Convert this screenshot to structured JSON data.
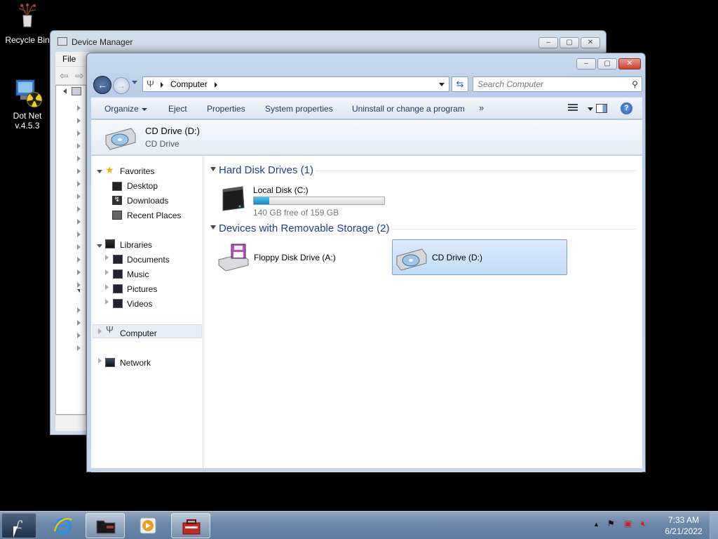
{
  "desktop": {
    "icons": [
      {
        "label": "Recycle Bin",
        "icon": "recycle-bin-icon"
      },
      {
        "label": "Dot Net\nv.4.5.3",
        "line1": "Dot Net",
        "line2": "v.4.5.3",
        "icon": "dotnet-installer-icon"
      }
    ]
  },
  "device_manager": {
    "title": "Device Manager",
    "menu": {
      "file": "File"
    }
  },
  "explorer": {
    "address": {
      "crumbs": [
        "Computer"
      ]
    },
    "search": {
      "placeholder": "Search Computer"
    },
    "commands": {
      "organize": "Organize",
      "eject": "Eject",
      "properties": "Properties",
      "system_properties": "System properties",
      "uninstall": "Uninstall or change a program",
      "more": "»"
    },
    "details": {
      "name": "CD Drive (D:)",
      "type": "CD Drive"
    },
    "nav": {
      "favorites": "Favorites",
      "desktop": "Desktop",
      "downloads": "Downloads",
      "recent": "Recent Places",
      "libraries": "Libraries",
      "documents": "Documents",
      "music": "Music",
      "pictures": "Pictures",
      "videos": "Videos",
      "computer": "Computer",
      "network": "Network"
    },
    "groups": {
      "hdd": {
        "title": "Hard Disk Drives (1)",
        "items": [
          {
            "name": "Local Disk (C:)",
            "free": "140 GB free of 159 GB",
            "used_fraction": 0.12
          }
        ]
      },
      "removable": {
        "title": "Devices with Removable Storage (2)",
        "items": [
          {
            "name": "Floppy Disk Drive (A:)"
          },
          {
            "name": "CD Drive (D:)",
            "selected": true
          }
        ]
      }
    }
  },
  "taskbar": {
    "clock": {
      "time": "7:33 AM",
      "date": "6/21/2022"
    },
    "tray_expand": "▲"
  },
  "colors": {
    "accent": "#1e3f8a",
    "selection": "#c2dcf8",
    "taskbar": "#6e89aa"
  }
}
